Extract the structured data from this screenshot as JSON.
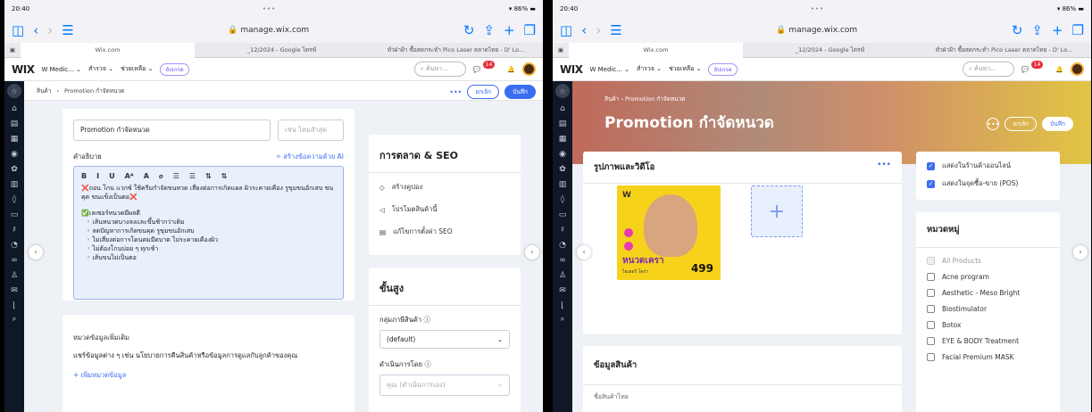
{
  "left": {
    "status_time": "20:40",
    "status_dots": "•••",
    "status_battery": "86%",
    "url": "manage.wix.com",
    "tabs": [
      "Wix.com",
      "_12/2024 - Google ไดรฟ์",
      "ทั่วฝ่าฝ้า ซื้อสดกระทำ Pico Laser ตลาดไทย - D' Lo..."
    ],
    "wix": {
      "logo": "WIX",
      "site": "W Medic...",
      "menu1": "สำรวจ",
      "menu2": "ช่วยเหลือ",
      "upgrade": "อัปเกรด",
      "search": "ค้นหา...",
      "notif": "14"
    },
    "breadcrumb": {
      "root": "สินค้า",
      "current": "Promotion กำจัดหนวด"
    },
    "actions": {
      "more": "•••",
      "cancel": "ยกเลิก",
      "save": "บันทึก"
    },
    "name_value": "Promotion กำจัดหนวด",
    "sku_placeholder": "เช่น ไหมสำสุด",
    "description_label": "คำอธิบาย",
    "ai_button": "✧ สร้างข้อความด้วย AI",
    "toolbar": [
      "B",
      "I",
      "U",
      "Aᴬ",
      "A",
      "⌀",
      "☰",
      "☰",
      "⇅",
      "⇅"
    ],
    "desc_line1": "❌ถอน โกน แวกซ์ ใช้ครีมกำจัดขนหวด เสี่ยงต่อการเกิดแผล ผิวระคายเคือง รูขุมขนอักเสบ ขนคุด ขนแข็งเป็นตอ❌",
    "desc_heading": "✅เลเซอร์หนวดมีผลดี",
    "desc_bullets": [
      "เส้นหนวดบางลงและขึ้นช้ากว่าเดิม",
      "ลดปัญหาการเกิดขนคุด รูขุมขนอักเสบ",
      "ไม่เสี่ยงต่อการโดนคมมีดบาด ไม่ระคายเคืองผิว",
      "ไม่ต้องโกนบ่อย ๆ ทุกเช้า",
      "เส้นขนไม่เป็นตอ"
    ],
    "extra_title": "หมวดข้อมูลเพิ่มเติม",
    "extra_desc": "แชร์ข้อมูลต่าง ๆ เช่น นโยบายการคืนสินค้าหรือข้อมูลการดูแลกับลูกค้าของคุณ",
    "extra_add": "+ เพิ่มหมวดข้อมูล",
    "seo_title": "การตลาด & SEO",
    "seo_items": [
      "สร้างคูปอง",
      "โปรโมตสินค้านี้",
      "แก้ไขการตั้งค่า SEO"
    ],
    "adv_title": "ขั้นสูง",
    "type_label": "กลุ่มภาษีสินค้า ⓘ",
    "type_value": "(default)",
    "fulfill_label": "ดำเนินการโดย ⓘ",
    "fulfill_placeholder": "คุณ (ดำเนินการเอง)"
  },
  "right": {
    "status_time": "20:40",
    "status_dots": "•••",
    "status_battery": "86%",
    "url": "manage.wix.com",
    "tabs": [
      "Wix.com",
      "_12/2024 - Google ไดรฟ์",
      "ทั่วฝ่าฝ้า ซื้อสดกระทำ Pico Laser ตลาดไทย - D' Lo..."
    ],
    "wix": {
      "logo": "WIX",
      "site": "W Medic...",
      "menu1": "สำรวจ",
      "menu2": "ช่วยเหลือ",
      "upgrade": "อัปเกรด",
      "search": "ค้นหา...",
      "notif": "14"
    },
    "breadcrumb": {
      "root": "สินค้า",
      "current": "Promotion กำจัดหนวด"
    },
    "title": "Promotion กำจัดหนวด",
    "actions": {
      "more": "•••",
      "cancel": "ยกเลิก",
      "save": "บันทึก"
    },
    "media_title": "รูปภาพและวิดีโอ",
    "media_more": "•••",
    "product_brand": "W",
    "product_label1": "หนวดเครา",
    "product_sub": "ไฮเลอร์ โคร่า",
    "product_price": "499",
    "info_title": "ข้อมูลสินค้า",
    "info_sub": "ชื่อสินค้าไทย",
    "visibility": [
      "แสดงในร้านค้าออนไลน์",
      "แสดงในจุดซื้อ-ขาย (POS)"
    ],
    "cat_title": "หมวดหมู่",
    "categories": [
      "All Products",
      "Acne program",
      "Aesthetic - Meso Bright",
      "Biostimulator",
      "Botox",
      "EYE & BODY Treatment",
      "Facial Premium MASK"
    ]
  }
}
